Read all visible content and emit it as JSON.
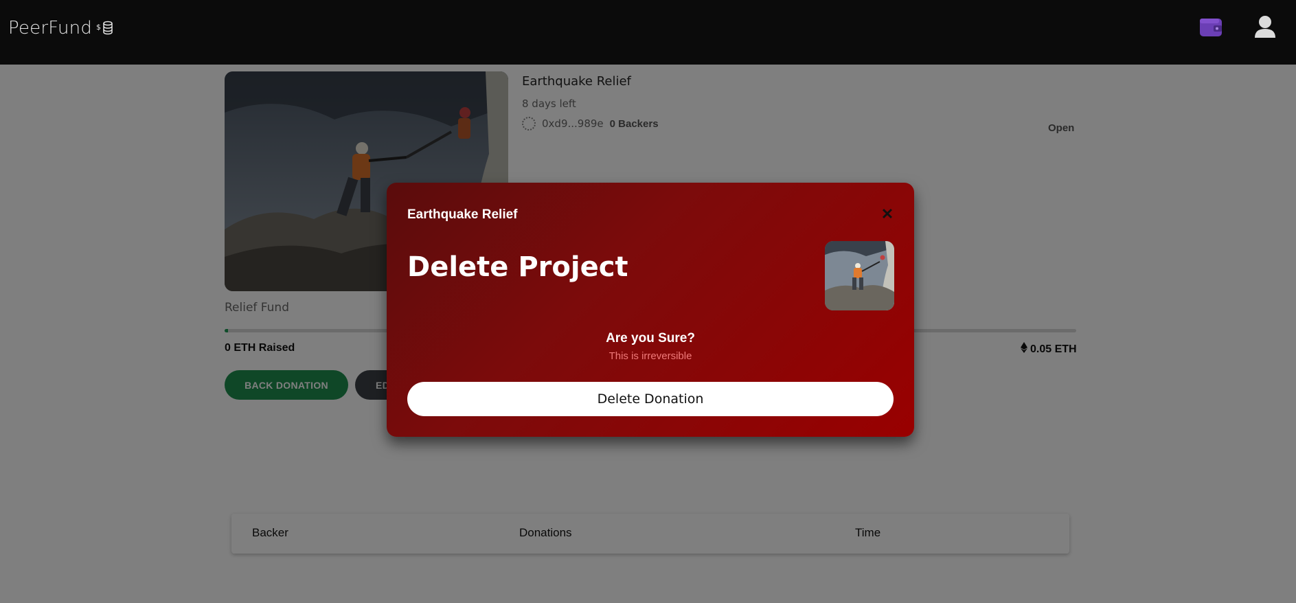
{
  "navbar": {
    "brand": "PeerFund",
    "brand_icon": "coins-dollar-icon",
    "wallet_icon": "wallet-icon",
    "user_icon": "user-icon",
    "wallet_color": "#6b3fb5"
  },
  "project": {
    "title": "Earthquake Relief",
    "days_left": "8 days left",
    "owner_address": "0xd9...989e",
    "backers": "0 Backers",
    "status": "Open",
    "category": "Relief Fund",
    "raised": "0 ETH Raised",
    "goal": "0.05 ETH",
    "progress_fraction": 0.003,
    "accent_green": "#1e9a55"
  },
  "actions": {
    "back_label": "BACK DONATION",
    "edit_label": "EDIT"
  },
  "table": {
    "headers": [
      "Backer",
      "Donations",
      "Time"
    ]
  },
  "modal": {
    "subtitle": "Earthquake Relief",
    "title": "Delete Project",
    "question": "Are you Sure?",
    "note": "This is irreversible",
    "delete_label": "Delete Donation",
    "close_icon": "close-icon",
    "gradient_start": "#5a0c0c",
    "gradient_end": "#990000"
  }
}
